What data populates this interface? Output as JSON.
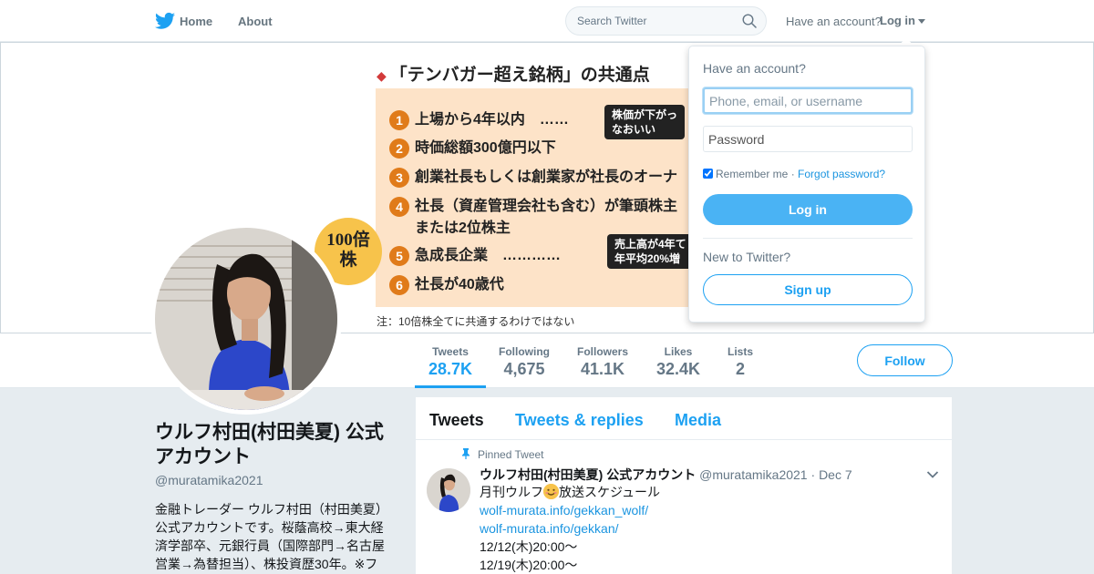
{
  "nav": {
    "home": "Home",
    "about": "About",
    "search_placeholder": "Search Twitter",
    "have_account": "Have an account?",
    "login": "Log in"
  },
  "banner": {
    "title": "「テンバガー超え銘柄」の共通点",
    "items": [
      {
        "num": "1",
        "text": "上場から4年以内　……"
      },
      {
        "num": "2",
        "text": "時価総額300億円以下"
      },
      {
        "num": "3",
        "text": "創業社長もしくは創業家が社長のオーナ"
      },
      {
        "num": "4",
        "text": "社長（資産管理会社も含む）が筆頭株主"
      },
      {
        "num": "",
        "text": "または2位株主"
      },
      {
        "num": "5",
        "text": "急成長企業　…………"
      },
      {
        "num": "6",
        "text": "社長が40歳代"
      }
    ],
    "callout_1": [
      "株価が下がっ",
      "なおいい"
    ],
    "callout_2": [
      "売上高が4年て",
      "年平均20%増"
    ],
    "bubble": [
      "100倍",
      "株"
    ],
    "note": "注：10倍株全てに共通するわけではない"
  },
  "stats": [
    {
      "label": "Tweets",
      "value": "28.7K"
    },
    {
      "label": "Following",
      "value": "4,675"
    },
    {
      "label": "Followers",
      "value": "41.1K"
    },
    {
      "label": "Likes",
      "value": "32.4K"
    },
    {
      "label": "Lists",
      "value": "2"
    }
  ],
  "follow_label": "Follow",
  "profile": {
    "name": "ウルフ村田(村田美夏) 公式アカウント",
    "handle": "@muratamika2021",
    "bio": "金融トレーダー ウルフ村田（村田美夏）公式アカウントです。桜蔭高校→東大経済学部卒、元銀行員（国際部門→名古屋営業→為替担当）、株投資歴30年。※フ"
  },
  "timeline": {
    "tabs": [
      "Tweets",
      "Tweets & replies",
      "Media"
    ],
    "pinned_label": "Pinned Tweet",
    "tweet": {
      "name": "ウルフ村田(村田美夏) 公式アカウント",
      "handle": "@muratamika2021",
      "sep": "·",
      "date": "Dec 7",
      "line1_before": "月刊ウルフ",
      "line1_after": "放送スケジュール",
      "link1": "wolf-murata.info/gekkan_wolf/",
      "link2": "wolf-murata.info/gekkan/",
      "line4": "12/12(木)20:00～",
      "line5": "12/19(木)20:00～"
    }
  },
  "login_dropdown": {
    "title": "Have an account?",
    "username_placeholder": "Phone, email, or username",
    "password_placeholder": "Password",
    "remember": "Remember me",
    "sep": " · ",
    "forgot": "Forgot password?",
    "login_button": "Log in",
    "new_to": "New to Twitter?",
    "signup_button": "Sign up"
  },
  "colors": {
    "accent": "#1da1f2",
    "login_button": "#4ab3f4",
    "background": "#e6ecf0"
  }
}
